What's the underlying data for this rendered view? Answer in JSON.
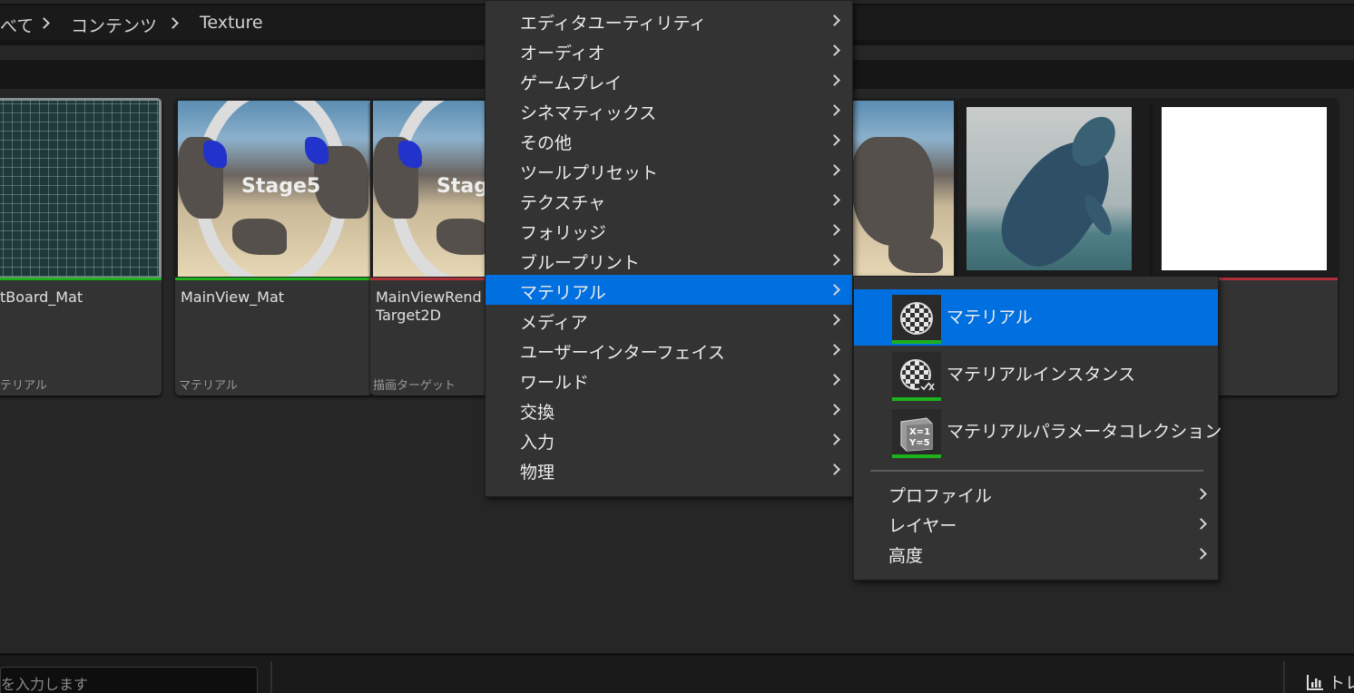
{
  "breadcrumb": {
    "items": [
      "べて",
      "コンテンツ",
      "Texture"
    ]
  },
  "assets": [
    {
      "name": "tBoard_Mat",
      "type": "テリアル",
      "bar_color": "#1db11d"
    },
    {
      "name": "MainView_Mat",
      "type": "マテリアル",
      "bar_color": "#1db11d"
    },
    {
      "name": "MainViewRend\nTarget2D",
      "type": "描画ターゲット",
      "bar_color": "#b0303a"
    },
    {
      "name": "",
      "type": "",
      "bar_color": ""
    },
    {
      "name": "",
      "type": "",
      "bar_color": ""
    },
    {
      "name": "",
      "type": "",
      "bar_color": "#b0303a"
    }
  ],
  "thumb_text": "Stage5",
  "context_menu": {
    "items": [
      {
        "label": "エディタユーティリティ"
      },
      {
        "label": "オーディオ"
      },
      {
        "label": "ゲームプレイ"
      },
      {
        "label": "シネマティックス"
      },
      {
        "label": "その他"
      },
      {
        "label": "ツールプリセット"
      },
      {
        "label": "テクスチャ"
      },
      {
        "label": "フォリッジ"
      },
      {
        "label": "ブループリント"
      },
      {
        "label": "マテリアル",
        "active": true
      },
      {
        "label": "メディア"
      },
      {
        "label": "ユーザーインターフェイス"
      },
      {
        "label": "ワールド"
      },
      {
        "label": "交換"
      },
      {
        "label": "入力"
      },
      {
        "label": "物理"
      }
    ]
  },
  "submenu": {
    "asset_items": [
      {
        "label": "マテリアル",
        "icon": "material-icon",
        "active": true
      },
      {
        "label": "マテリアルインスタンス",
        "icon": "material-instance-icon"
      },
      {
        "label": "マテリアルパラメータコレクション",
        "icon": "material-parameter-collection-icon",
        "icon_text": [
          "X=1",
          "Y=5"
        ]
      }
    ],
    "category_items": [
      {
        "label": "プロファイル"
      },
      {
        "label": "レイヤー"
      },
      {
        "label": "高度"
      }
    ]
  },
  "status": {
    "search_placeholder": "を入力します",
    "trace_label": "トレ"
  },
  "colors": {
    "accent": "#0070e0",
    "material_green": "#1db11d",
    "render_target_red": "#b0303a",
    "menu_bg": "#333333"
  }
}
